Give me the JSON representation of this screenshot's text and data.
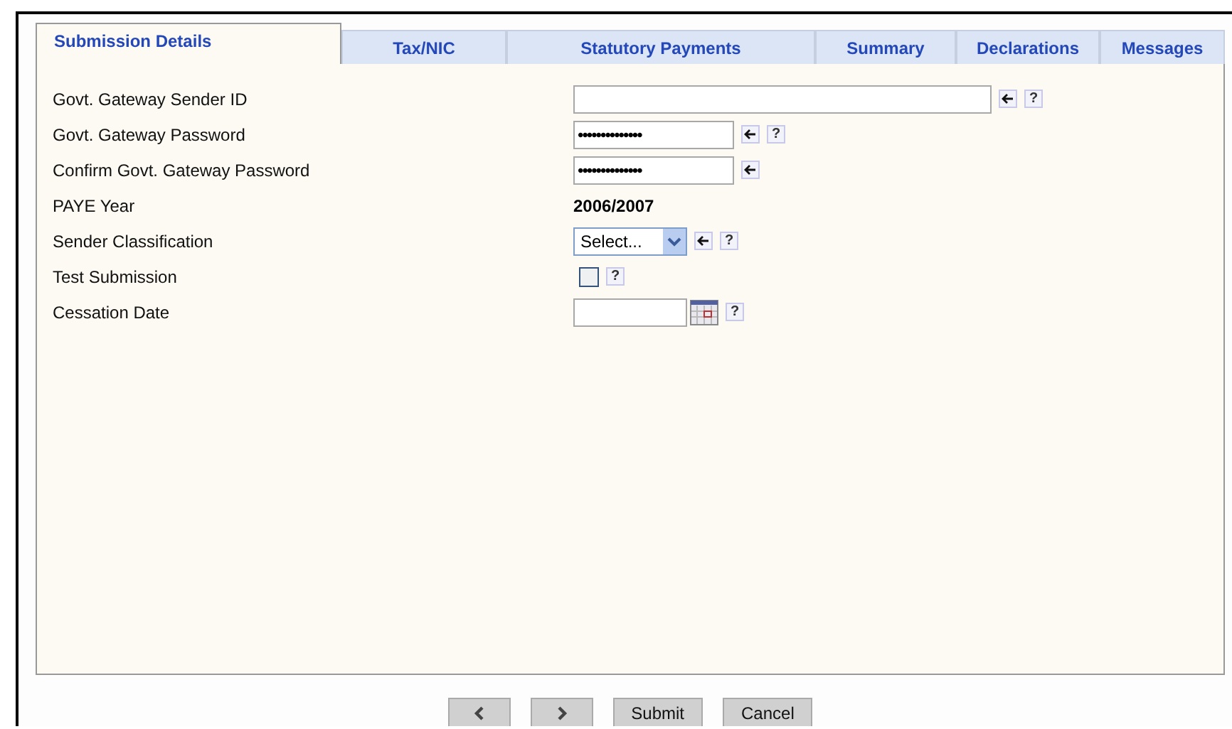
{
  "tabs": [
    {
      "label": "Submission Details",
      "selected": true
    },
    {
      "label": "Tax/NIC",
      "selected": false
    },
    {
      "label": "Statutory Payments",
      "selected": false
    },
    {
      "label": "Summary",
      "selected": false
    },
    {
      "label": "Declarations",
      "selected": false
    },
    {
      "label": "Messages",
      "selected": false
    }
  ],
  "fields": [
    {
      "kind": "text",
      "label": "Govt. Gateway Sender ID",
      "arrow": true,
      "help": "?"
    },
    {
      "kind": "password",
      "label": "Govt. Gateway Password",
      "value": "••••••••••••••",
      "arrow": true,
      "help": "?"
    },
    {
      "kind": "password",
      "label": "Confirm Govt. Gateway Password",
      "value": "••••••••••••••",
      "arrow": true
    },
    {
      "kind": "static",
      "label": "PAYE Year",
      "value": "2006/2007",
      "arrow": false
    },
    {
      "kind": "select",
      "label": "Sender Classification",
      "value": "Select...",
      "arrow": true,
      "help": "?"
    },
    {
      "kind": "checkbox",
      "label": "Test Submission",
      "checked": false,
      "arrow": false,
      "help": "?"
    },
    {
      "kind": "date",
      "label": "Cessation Date",
      "arrow": false,
      "help": "?"
    }
  ],
  "buttons": [
    {
      "kind": "prev"
    },
    {
      "kind": "next"
    },
    {
      "kind": "text",
      "label": "Submit"
    },
    {
      "kind": "text",
      "label": "Cancel"
    }
  ]
}
